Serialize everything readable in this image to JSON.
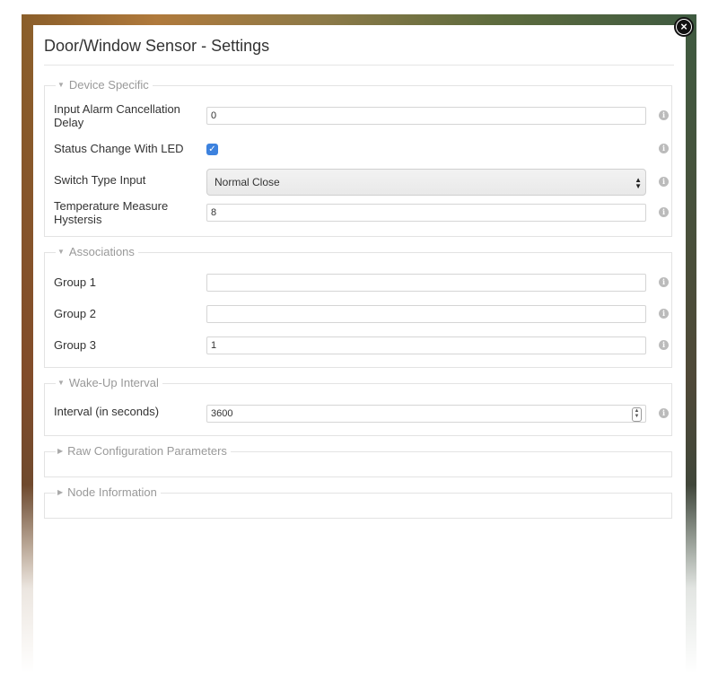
{
  "dialog": {
    "title": "Door/Window Sensor - Settings",
    "close_icon": "close-icon"
  },
  "device_specific": {
    "legend": "Device Specific",
    "input_alarm": {
      "label": "Input Alarm Cancellation Delay",
      "value": "0"
    },
    "status_led": {
      "label": "Status Change With LED",
      "checked": true
    },
    "switch_type": {
      "label": "Switch Type Input",
      "selected": "Normal Close"
    },
    "temp_hysteresis": {
      "label": "Temperature Measure Hystersis",
      "value": "8"
    }
  },
  "associations": {
    "legend": "Associations",
    "group1": {
      "label": "Group 1",
      "value": ""
    },
    "group2": {
      "label": "Group 2",
      "value": ""
    },
    "group3": {
      "label": "Group 3",
      "value": "1"
    }
  },
  "wakeup": {
    "legend": "Wake-Up Interval",
    "interval": {
      "label": "Interval (in seconds)",
      "value": "3600"
    }
  },
  "raw_config": {
    "legend": "Raw Configuration Parameters"
  },
  "node_info": {
    "legend": "Node Information"
  },
  "icons": {
    "info": "info-icon",
    "expanded": "caret-down-icon",
    "collapsed": "caret-right-icon"
  },
  "colors": {
    "checkbox": "#3d82de"
  }
}
